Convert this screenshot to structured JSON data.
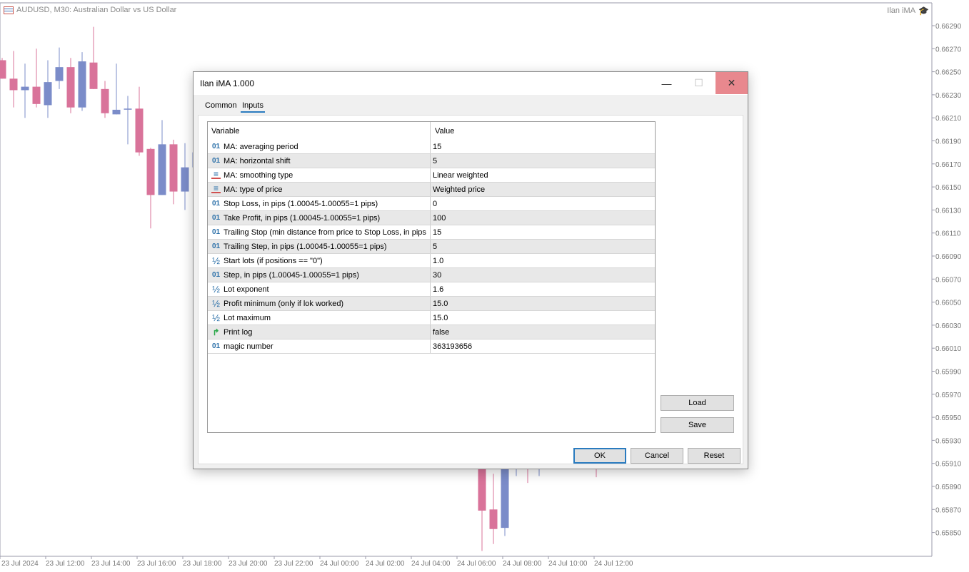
{
  "chart": {
    "title": "AUDUSD, M30:  Australian Dollar vs US Dollar",
    "ea_name": "Ilan iMA",
    "ea_icon": "graduation-cap-icon",
    "colors": {
      "bull": "#7b8cc9",
      "bear": "#d9739a",
      "axis": "#9a9aaa"
    }
  },
  "chart_data": {
    "type": "candlestick",
    "symbol": "AUDUSD",
    "timeframe": "M30",
    "ylim": [
      0.65835,
      0.663
    ],
    "price_ticks": [
      "0.66290",
      "0.66270",
      "0.66250",
      "0.66230",
      "0.66210",
      "0.66190",
      "0.66170",
      "0.66150",
      "0.66130",
      "0.66110",
      "0.66090",
      "0.66070",
      "0.66050",
      "0.66030",
      "0.66010",
      "0.65990",
      "0.65970",
      "0.65950",
      "0.65930",
      "0.65910",
      "0.65890",
      "0.65870",
      "0.65850"
    ],
    "time_ticks": [
      "23 Jul 2024",
      "23 Jul 12:00",
      "23 Jul 14:00",
      "23 Jul 16:00",
      "23 Jul 18:00",
      "23 Jul 20:00",
      "23 Jul 22:00",
      "24 Jul 00:00",
      "24 Jul 02:00",
      "24 Jul 04:00",
      "24 Jul 06:00",
      "24 Jul 08:00",
      "24 Jul 10:00",
      "24 Jul 12:00"
    ],
    "candles": [
      {
        "i": 0,
        "o": 0.6626,
        "h": 0.66262,
        "l": 0.66244,
        "c": 0.66244
      },
      {
        "i": 1,
        "o": 0.66244,
        "h": 0.66268,
        "l": 0.66219,
        "c": 0.66234
      },
      {
        "i": 2,
        "o": 0.66234,
        "h": 0.66257,
        "l": 0.6621,
        "c": 0.66237
      },
      {
        "i": 3,
        "o": 0.66237,
        "h": 0.6627,
        "l": 0.66219,
        "c": 0.66222
      },
      {
        "i": 4,
        "o": 0.66221,
        "h": 0.6626,
        "l": 0.6621,
        "c": 0.66241
      },
      {
        "i": 5,
        "o": 0.66242,
        "h": 0.66271,
        "l": 0.66235,
        "c": 0.66254
      },
      {
        "i": 6,
        "o": 0.66254,
        "h": 0.66262,
        "l": 0.66214,
        "c": 0.66219
      },
      {
        "i": 7,
        "o": 0.66219,
        "h": 0.66267,
        "l": 0.66216,
        "c": 0.66259
      },
      {
        "i": 8,
        "o": 0.66258,
        "h": 0.66289,
        "l": 0.66235,
        "c": 0.66235
      },
      {
        "i": 9,
        "o": 0.66235,
        "h": 0.66242,
        "l": 0.6621,
        "c": 0.66214
      },
      {
        "i": 10,
        "o": 0.66213,
        "h": 0.66257,
        "l": 0.66213,
        "c": 0.66217
      },
      {
        "i": 11,
        "o": 0.66218,
        "h": 0.66229,
        "l": 0.66187,
        "c": 0.66218
      },
      {
        "i": 12,
        "o": 0.66218,
        "h": 0.66237,
        "l": 0.66177,
        "c": 0.6618
      },
      {
        "i": 13,
        "o": 0.66183,
        "h": 0.66184,
        "l": 0.66114,
        "c": 0.66143
      },
      {
        "i": 14,
        "o": 0.66143,
        "h": 0.66208,
        "l": 0.66143,
        "c": 0.66187
      },
      {
        "i": 15,
        "o": 0.66187,
        "h": 0.66191,
        "l": 0.66135,
        "c": 0.66146
      },
      {
        "i": 16,
        "o": 0.66146,
        "h": 0.66188,
        "l": 0.6613,
        "c": 0.66167
      },
      {
        "i": 17,
        "o": 0.66167,
        "h": 0.6619,
        "l": 0.6616,
        "c": 0.6618
      },
      {
        "i": 42,
        "o": 0.6596,
        "h": 0.6599,
        "l": 0.65834,
        "c": 0.65869
      },
      {
        "i": 43,
        "o": 0.6587,
        "h": 0.65901,
        "l": 0.6584,
        "c": 0.65853
      },
      {
        "i": 44,
        "o": 0.65854,
        "h": 0.6596,
        "l": 0.65847,
        "c": 0.6595
      },
      {
        "i": 45,
        "o": 0.6593,
        "h": 0.6595,
        "l": 0.65899,
        "c": 0.6594
      },
      {
        "i": 46,
        "o": 0.6594,
        "h": 0.6595,
        "l": 0.65893,
        "c": 0.6593
      },
      {
        "i": 47,
        "o": 0.6592,
        "h": 0.6594,
        "l": 0.65899,
        "c": 0.6593
      },
      {
        "i": 52,
        "o": 0.6594,
        "h": 0.6595,
        "l": 0.65898,
        "c": 0.6593
      }
    ]
  },
  "dialog": {
    "title": "Ilan iMA 1.000",
    "tabs": [
      "Common",
      "Inputs"
    ],
    "active_tab": "Inputs",
    "columns": [
      "Variable",
      "Value"
    ],
    "rows": [
      {
        "icon": "01",
        "type": "int",
        "variable": "MA: averaging period",
        "value": "15"
      },
      {
        "icon": "01",
        "type": "int",
        "variable": "MA: horizontal shift",
        "value": "5"
      },
      {
        "icon": "≡",
        "type": "enum",
        "variable": "MA: smoothing type",
        "value": "Linear weighted"
      },
      {
        "icon": "≡",
        "type": "enum",
        "variable": "MA: type of price",
        "value": "Weighted price"
      },
      {
        "icon": "01",
        "type": "int",
        "variable": "Stop Loss, in pips (1.00045-1.00055=1 pips)",
        "value": "0"
      },
      {
        "icon": "01",
        "type": "int",
        "variable": "Take Profit, in pips (1.00045-1.00055=1 pips)",
        "value": "100"
      },
      {
        "icon": "01",
        "type": "int",
        "variable": "Trailing Stop (min distance from price to Stop Loss, in pips",
        "value": "15"
      },
      {
        "icon": "01",
        "type": "int",
        "variable": "Trailing Step, in pips (1.00045-1.00055=1 pips)",
        "value": "5"
      },
      {
        "icon": "½",
        "type": "half",
        "variable": "Start lots (if positions == \"0\")",
        "value": "1.0"
      },
      {
        "icon": "01",
        "type": "int",
        "variable": "Step, in pips (1.00045-1.00055=1 pips)",
        "value": "30"
      },
      {
        "icon": "½",
        "type": "half",
        "variable": "Lot exponent",
        "value": "1.6"
      },
      {
        "icon": "½",
        "type": "half",
        "variable": "Profit minimum (only if lok worked)",
        "value": "15.0"
      },
      {
        "icon": "½",
        "type": "half",
        "variable": "Lot maximum",
        "value": "15.0"
      },
      {
        "icon": "↱",
        "type": "bool",
        "variable": "Print log",
        "value": "false"
      },
      {
        "icon": "01",
        "type": "int",
        "variable": "magic number",
        "value": "363193656"
      }
    ],
    "buttons": {
      "load": "Load",
      "save": "Save",
      "ok": "OK",
      "cancel": "Cancel",
      "reset": "Reset"
    },
    "window_buttons": {
      "minimize": "—",
      "maximize": "☐",
      "close": "✕"
    }
  }
}
